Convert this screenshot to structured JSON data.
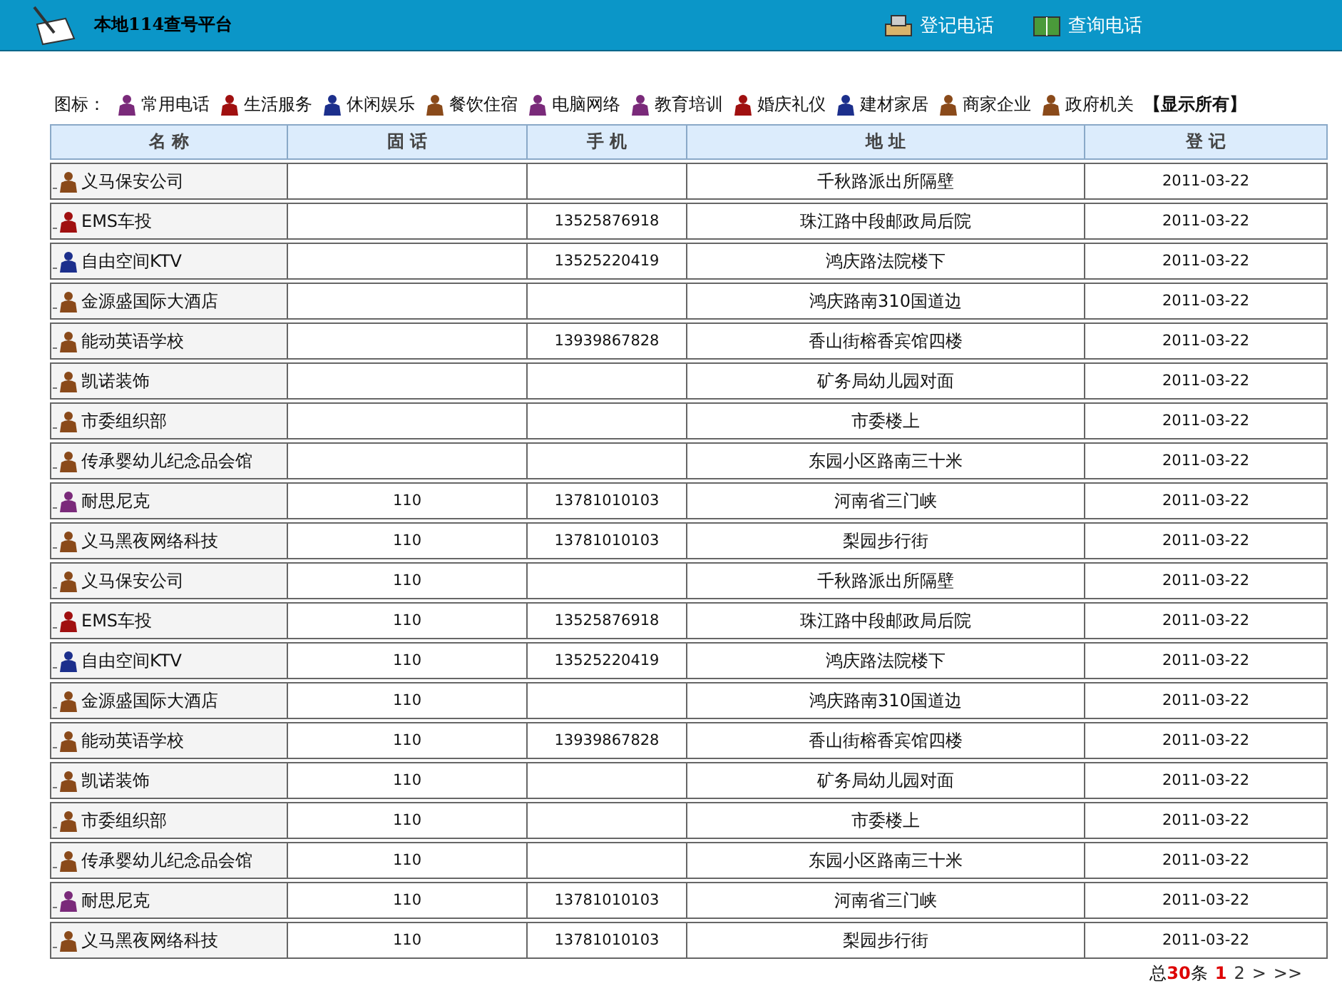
{
  "header": {
    "title": "本地114查号平台",
    "links": [
      {
        "label": "登记电话"
      },
      {
        "label": "查询电话"
      }
    ]
  },
  "legend": {
    "label": "图标：",
    "items": [
      {
        "label": "常用电话",
        "color": "#7a2a7a"
      },
      {
        "label": "生活服务",
        "color": "#a01010"
      },
      {
        "label": "休闲娱乐",
        "color": "#1c2f8c"
      },
      {
        "label": "餐饮住宿",
        "color": "#8a4a1a"
      },
      {
        "label": "电脑网络",
        "color": "#7a2a7a"
      },
      {
        "label": "教育培训",
        "color": "#7a2a7a"
      },
      {
        "label": "婚庆礼仪",
        "color": "#a01010"
      },
      {
        "label": "建材家居",
        "color": "#1c2f8c"
      },
      {
        "label": "商家企业",
        "color": "#8a4a1a"
      },
      {
        "label": "政府机关",
        "color": "#8a4a1a"
      }
    ],
    "show_all": "【显示所有】"
  },
  "table": {
    "columns": [
      "名 称",
      "固 话",
      "手 机",
      "地 址",
      "登 记"
    ],
    "rows": [
      {
        "color": "#8a4a1a",
        "name": "义马保安公司",
        "phone": "",
        "mobile": "",
        "address": "千秋路派出所隔壁",
        "date": "2011-03-22"
      },
      {
        "color": "#a01010",
        "name": "EMS车投",
        "phone": "",
        "mobile": "13525876918",
        "address": "珠江路中段邮政局后院",
        "date": "2011-03-22"
      },
      {
        "color": "#1c2f8c",
        "name": "自由空间KTV",
        "phone": "",
        "mobile": "13525220419",
        "address": "鸿庆路法院楼下",
        "date": "2011-03-22"
      },
      {
        "color": "#8a4a1a",
        "name": "金源盛国际大酒店",
        "phone": "",
        "mobile": "",
        "address": "鸿庆路南310国道边",
        "date": "2011-03-22"
      },
      {
        "color": "#8a4a1a",
        "name": "能动英语学校",
        "phone": "",
        "mobile": "13939867828",
        "address": "香山街榕香宾馆四楼",
        "date": "2011-03-22"
      },
      {
        "color": "#8a4a1a",
        "name": "凯诺装饰",
        "phone": "",
        "mobile": "",
        "address": "矿务局幼儿园对面",
        "date": "2011-03-22"
      },
      {
        "color": "#8a4a1a",
        "name": "市委组织部",
        "phone": "",
        "mobile": "",
        "address": "市委楼上",
        "date": "2011-03-22"
      },
      {
        "color": "#8a4a1a",
        "name": "传承婴幼儿纪念品会馆",
        "phone": "",
        "mobile": "",
        "address": "东园小区路南三十米",
        "date": "2011-03-22"
      },
      {
        "color": "#7a2a7a",
        "name": "耐思尼克",
        "phone": "110",
        "mobile": "13781010103",
        "address": "河南省三门峡",
        "date": "2011-03-22"
      },
      {
        "color": "#8a4a1a",
        "name": "义马黑夜网络科技",
        "phone": "110",
        "mobile": "13781010103",
        "address": "梨园步行街",
        "date": "2011-03-22"
      },
      {
        "color": "#8a4a1a",
        "name": "义马保安公司",
        "phone": "110",
        "mobile": "",
        "address": "千秋路派出所隔壁",
        "date": "2011-03-22"
      },
      {
        "color": "#a01010",
        "name": "EMS车投",
        "phone": "110",
        "mobile": "13525876918",
        "address": "珠江路中段邮政局后院",
        "date": "2011-03-22"
      },
      {
        "color": "#1c2f8c",
        "name": "自由空间KTV",
        "phone": "110",
        "mobile": "13525220419",
        "address": "鸿庆路法院楼下",
        "date": "2011-03-22"
      },
      {
        "color": "#8a4a1a",
        "name": "金源盛国际大酒店",
        "phone": "110",
        "mobile": "",
        "address": "鸿庆路南310国道边",
        "date": "2011-03-22"
      },
      {
        "color": "#8a4a1a",
        "name": "能动英语学校",
        "phone": "110",
        "mobile": "13939867828",
        "address": "香山街榕香宾馆四楼",
        "date": "2011-03-22"
      },
      {
        "color": "#8a4a1a",
        "name": "凯诺装饰",
        "phone": "110",
        "mobile": "",
        "address": "矿务局幼儿园对面",
        "date": "2011-03-22"
      },
      {
        "color": "#8a4a1a",
        "name": "市委组织部",
        "phone": "110",
        "mobile": "",
        "address": "市委楼上",
        "date": "2011-03-22"
      },
      {
        "color": "#8a4a1a",
        "name": "传承婴幼儿纪念品会馆",
        "phone": "110",
        "mobile": "",
        "address": "东园小区路南三十米",
        "date": "2011-03-22"
      },
      {
        "color": "#7a2a7a",
        "name": "耐思尼克",
        "phone": "110",
        "mobile": "13781010103",
        "address": "河南省三门峡",
        "date": "2011-03-22"
      },
      {
        "color": "#8a4a1a",
        "name": "义马黑夜网络科技",
        "phone": "110",
        "mobile": "13781010103",
        "address": "梨园步行街",
        "date": "2011-03-22"
      }
    ]
  },
  "pagination": {
    "total_prefix": "总",
    "total": "30",
    "total_suffix": "条",
    "pages": [
      {
        "label": "1",
        "selected": true
      },
      {
        "label": "2",
        "selected": false
      }
    ],
    "next": ">",
    "last": ">>"
  }
}
